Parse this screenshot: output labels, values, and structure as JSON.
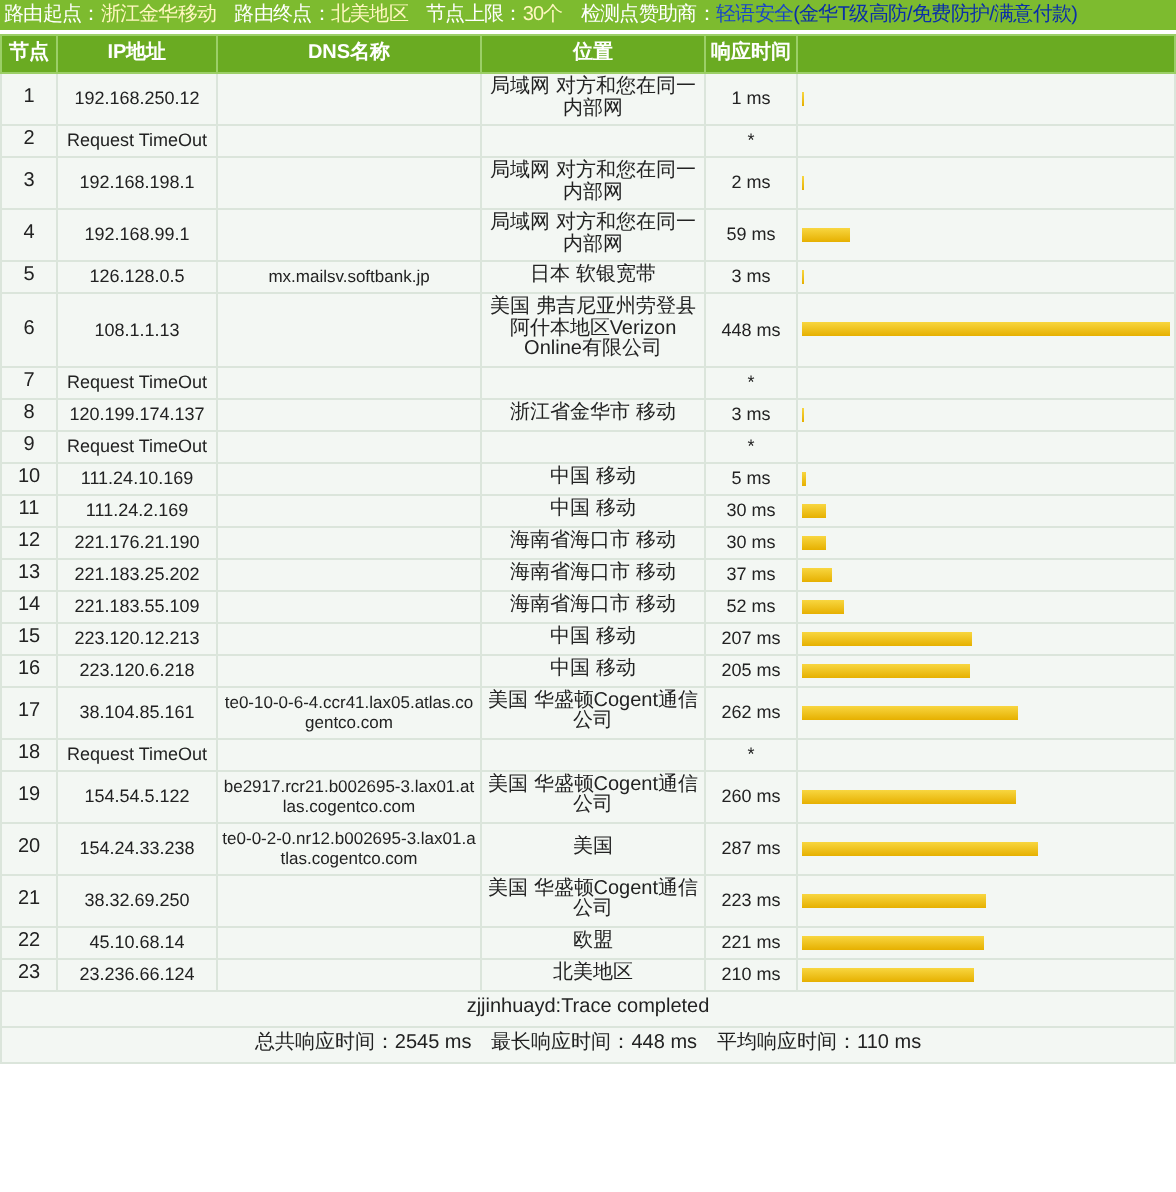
{
  "route_info": [
    {
      "label": "路由起点：",
      "value": "浙江金华移动"
    },
    {
      "label": "路由终点：",
      "value": "北美地区"
    },
    {
      "label": "节点上限：",
      "value": "30个"
    }
  ],
  "sponsor": {
    "label": "检测点赞助商：",
    "name": "轻语安全",
    "note": "(金华T级高防/免费防护/满意付款)"
  },
  "table": {
    "columns": [
      "节点",
      "IP地址",
      "DNS名称",
      "位置",
      "响应时间"
    ],
    "rows": [
      {
        "hop": "1",
        "ip": "192.168.250.12",
        "location": "局域网 对方和您在同一内部网",
        "time": "1 ms",
        "level": 0.002
      },
      {
        "hop": "2",
        "ip": "Request TimeOut",
        "time": "*"
      },
      {
        "hop": "3",
        "ip": "192.168.198.1",
        "location": "局域网 对方和您在同一内部网",
        "time": "2 ms",
        "level": 0.004
      },
      {
        "hop": "4",
        "ip": "192.168.99.1",
        "location": "局域网 对方和您在同一内部网",
        "time": "59 ms",
        "level": 0.13
      },
      {
        "hop": "5",
        "ip": "126.128.0.5",
        "dns": "mx.mailsv.softbank.jp",
        "location": "日本 软银宽带",
        "time": "3 ms",
        "level": 0.007
      },
      {
        "hop": "6",
        "ip": "108.1.1.13",
        "location": "美国 弗吉尼亚州劳登县阿什本地区Verizon Online有限公司",
        "time": "448 ms",
        "level": 1
      },
      {
        "hop": "7",
        "ip": "Request TimeOut",
        "time": "*"
      },
      {
        "hop": "8",
        "ip": "120.199.174.137",
        "location": "浙江省金华市 移动",
        "time": "3 ms",
        "level": 0.007
      },
      {
        "hop": "9",
        "ip": "Request TimeOut",
        "time": "*"
      },
      {
        "hop": "10",
        "ip": "111.24.10.169",
        "location": "中国 移动",
        "time": "5 ms",
        "level": 0.011
      },
      {
        "hop": "11",
        "ip": "111.24.2.169",
        "location": "中国 移动",
        "time": "30 ms",
        "level": 0.067
      },
      {
        "hop": "12",
        "ip": "221.176.21.190",
        "location": "海南省海口市 移动",
        "time": "30 ms",
        "level": 0.067
      },
      {
        "hop": "13",
        "ip": "221.183.25.202",
        "location": "海南省海口市 移动",
        "time": "37 ms",
        "level": 0.083
      },
      {
        "hop": "14",
        "ip": "221.183.55.109",
        "location": "海南省海口市 移动",
        "time": "52 ms",
        "level": 0.116
      },
      {
        "hop": "15",
        "ip": "223.120.12.213",
        "location": "中国 移动",
        "time": "207 ms",
        "level": 0.462
      },
      {
        "hop": "16",
        "ip": "223.120.6.218",
        "location": "中国 移动",
        "time": "205 ms",
        "level": 0.458
      },
      {
        "hop": "17",
        "ip": "38.104.85.161",
        "dns": "te0-10-0-6-4.ccr41.lax05.atlas.cogentco.com",
        "location": "美国 华盛顿Cogent通信公司",
        "time": "262 ms",
        "level": 0.585
      },
      {
        "hop": "18",
        "ip": "Request TimeOut",
        "time": "*"
      },
      {
        "hop": "19",
        "ip": "154.54.5.122",
        "dns": "be2917.rcr21.b002695-3.lax01.atlas.cogentco.com",
        "location": "美国 华盛顿Cogent通信公司",
        "time": "260 ms",
        "level": 0.58
      },
      {
        "hop": "20",
        "ip": "154.24.33.238",
        "dns": "te0-0-2-0.nr12.b002695-3.lax01.atlas.cogentco.com",
        "location": "美国",
        "time": "287 ms",
        "level": 0.64
      },
      {
        "hop": "21",
        "ip": "38.32.69.250",
        "location": "美国 华盛顿Cogent通信公司",
        "time": "223 ms",
        "level": 0.498
      },
      {
        "hop": "22",
        "ip": "45.10.68.14",
        "location": "欧盟",
        "time": "221 ms",
        "level": 0.493
      },
      {
        "hop": "23",
        "ip": "23.236.66.124",
        "location": "北美地区",
        "time": "210 ms",
        "level": 0.469
      }
    ],
    "trace_status": "zjjinhuayd:Trace completed",
    "summary": "总共响应时间：2545 ms　最长响应时间：448 ms　平均响应时间：110 ms"
  }
}
